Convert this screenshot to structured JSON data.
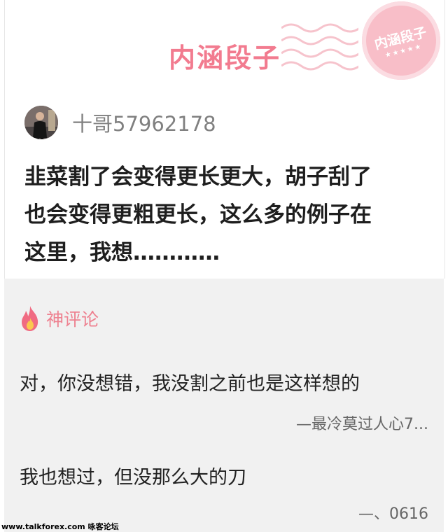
{
  "header": {
    "brand_title": "内涵段子",
    "stamp_text": "内涵段子",
    "stamp_stars": "★★★★★"
  },
  "post": {
    "author_name": "十哥57962178",
    "lines": [
      "韭菜割了会变得更长更大，胡子刮了",
      "也会变得更粗更长，这么多的例子在",
      "这里，我想…………"
    ]
  },
  "comments_section": {
    "title": "神评论",
    "items": [
      {
        "text": "对，你没想错，我没割之前也是这样想的",
        "user": "—最冷莫过人心7..."
      },
      {
        "text": "我也想过，但没那么大的刀",
        "user": "—、0616"
      }
    ]
  },
  "watermark": "www.talkforex.com 咏客论坛",
  "colors": {
    "accent_pink": "#f27b8f",
    "comment_bg": "#f1f1f1",
    "name_gray": "#808080"
  }
}
